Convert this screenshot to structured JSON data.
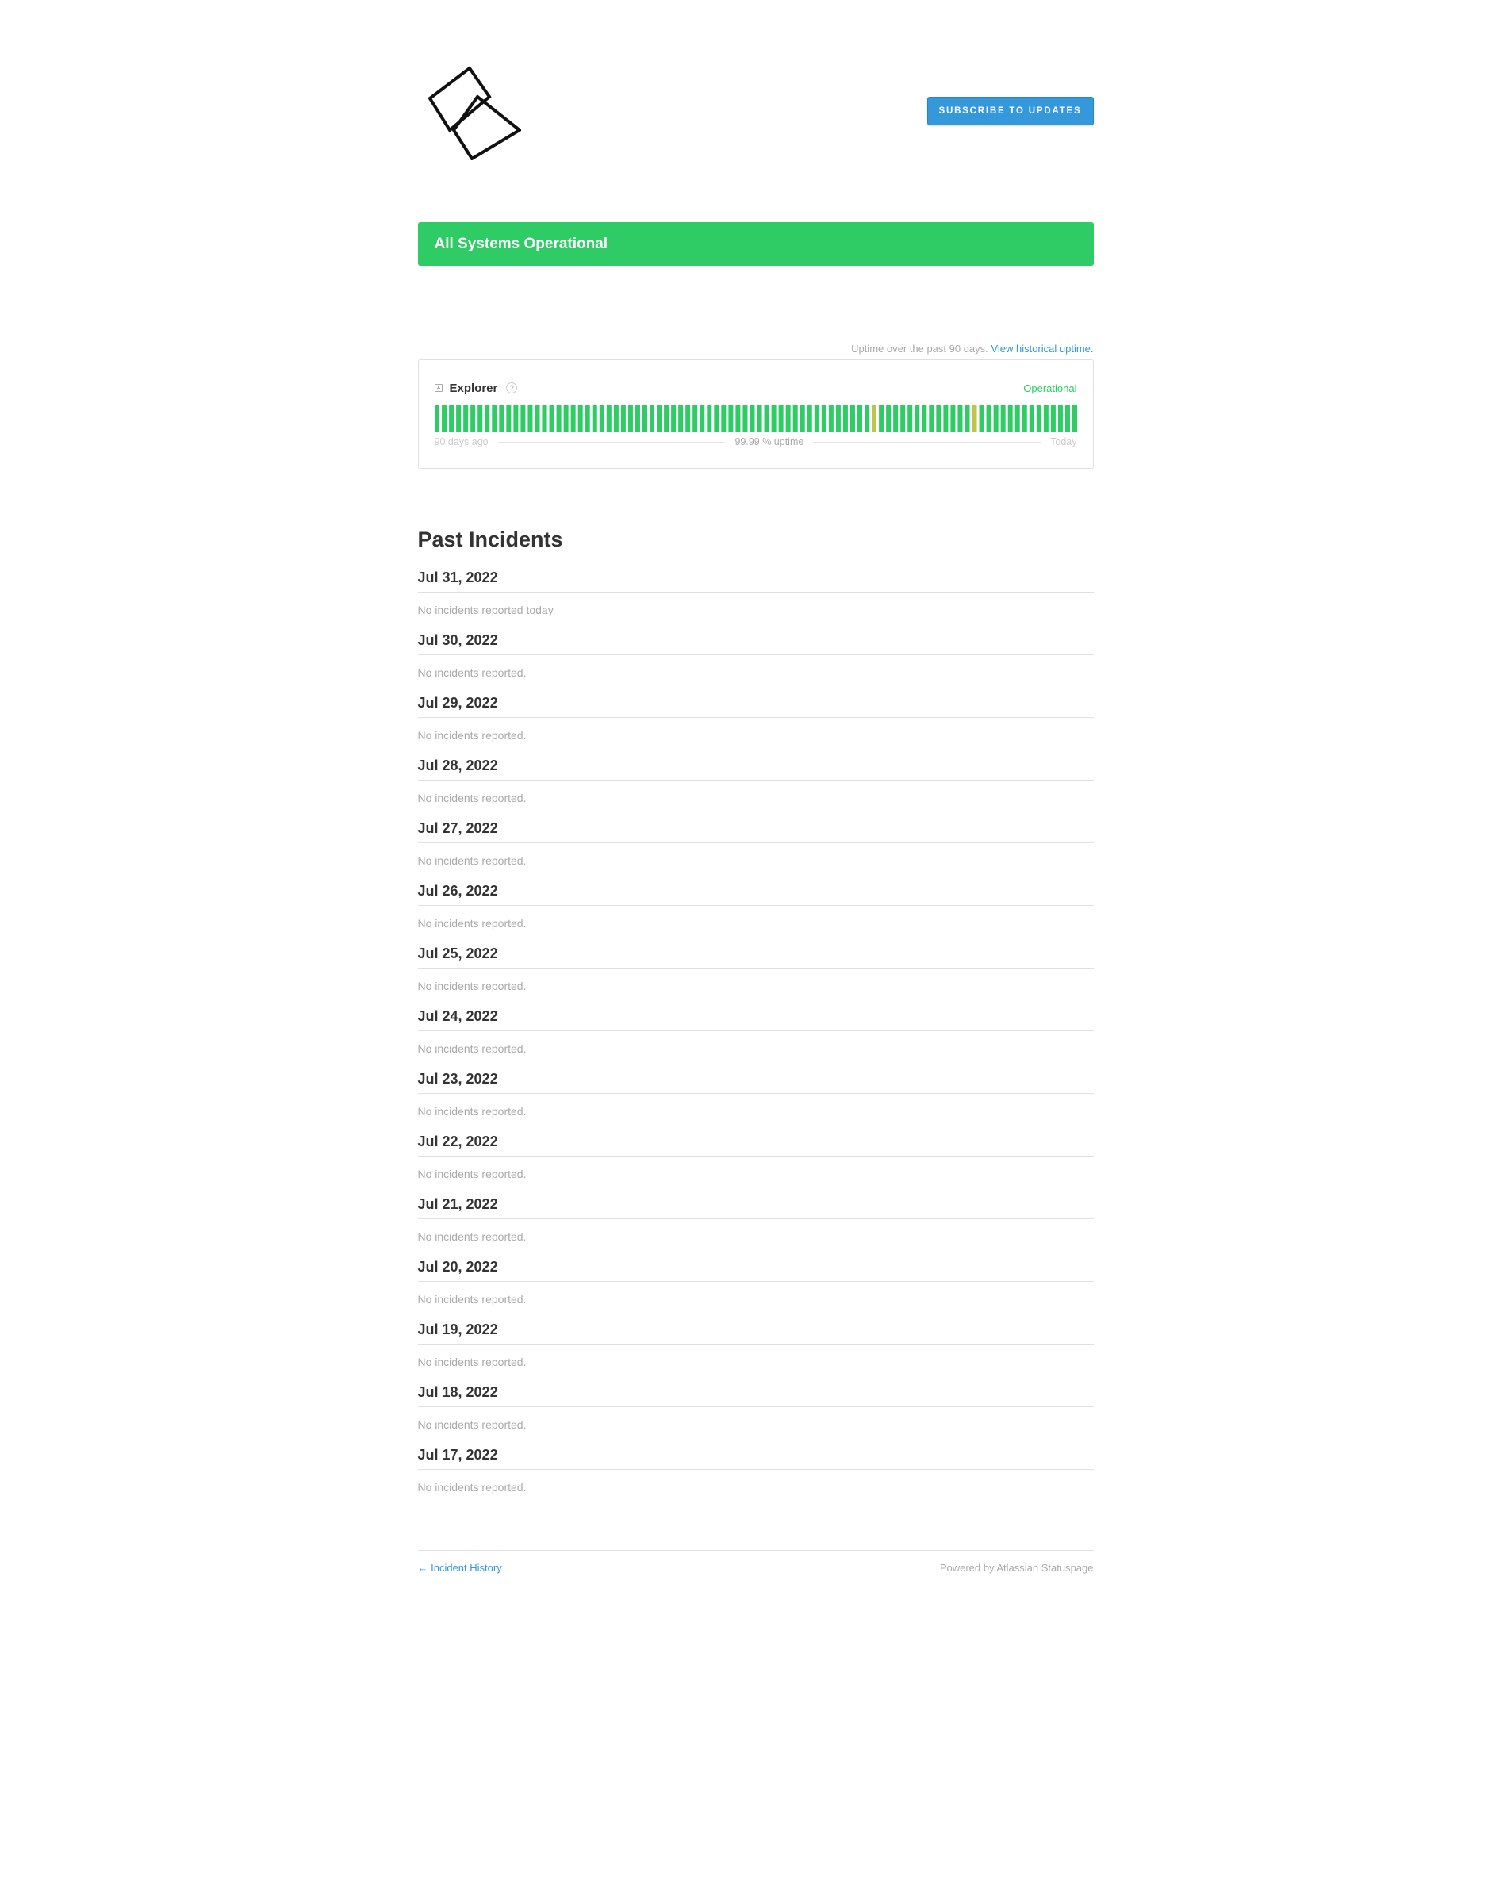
{
  "header": {
    "subscribe_label": "Subscribe to Updates"
  },
  "status_banner": {
    "text": "All Systems Operational"
  },
  "uptime": {
    "caption": "Uptime over the past 90 days.",
    "history_link": "View historical uptime."
  },
  "component": {
    "name": "Explorer",
    "help": "?",
    "status": "Operational",
    "legend_start": "90 days ago",
    "legend_mid": "99.99 % uptime",
    "legend_end": "Today",
    "colors": {
      "operational": "#2fcc66",
      "degraded": "#c0c44a"
    },
    "bars": {
      "count": 90,
      "degraded_days": [
        61,
        75
      ]
    }
  },
  "past_incidents": {
    "title": "Past Incidents",
    "days": [
      {
        "date": "Jul 31, 2022",
        "text": "No incidents reported today."
      },
      {
        "date": "Jul 30, 2022",
        "text": "No incidents reported."
      },
      {
        "date": "Jul 29, 2022",
        "text": "No incidents reported."
      },
      {
        "date": "Jul 28, 2022",
        "text": "No incidents reported."
      },
      {
        "date": "Jul 27, 2022",
        "text": "No incidents reported."
      },
      {
        "date": "Jul 26, 2022",
        "text": "No incidents reported."
      },
      {
        "date": "Jul 25, 2022",
        "text": "No incidents reported."
      },
      {
        "date": "Jul 24, 2022",
        "text": "No incidents reported."
      },
      {
        "date": "Jul 23, 2022",
        "text": "No incidents reported."
      },
      {
        "date": "Jul 22, 2022",
        "text": "No incidents reported."
      },
      {
        "date": "Jul 21, 2022",
        "text": "No incidents reported."
      },
      {
        "date": "Jul 20, 2022",
        "text": "No incidents reported."
      },
      {
        "date": "Jul 19, 2022",
        "text": "No incidents reported."
      },
      {
        "date": "Jul 18, 2022",
        "text": "No incidents reported."
      },
      {
        "date": "Jul 17, 2022",
        "text": "No incidents reported."
      }
    ]
  },
  "footer": {
    "history_link": "← Incident History",
    "powered_by": "Powered by Atlassian Statuspage"
  },
  "brand": {
    "accent": "#3498db",
    "success": "#2fcc66"
  }
}
